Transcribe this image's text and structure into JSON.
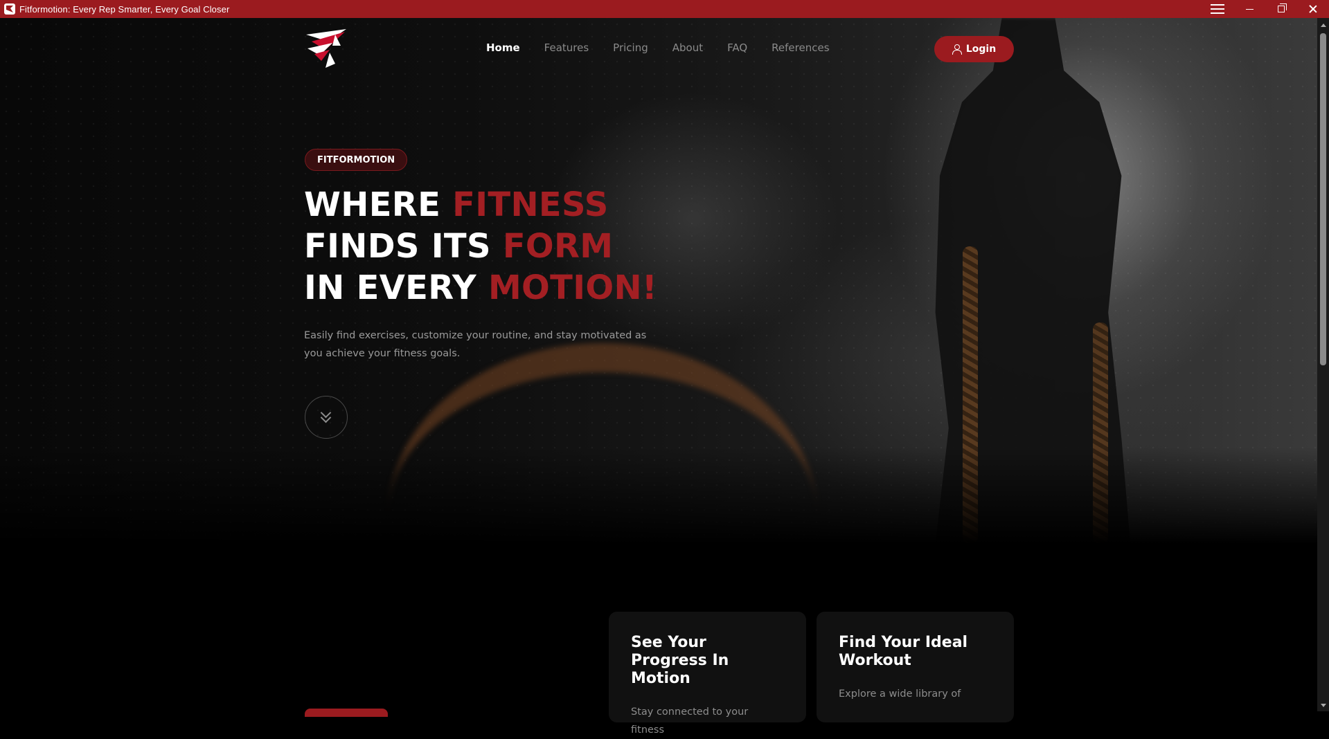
{
  "window": {
    "title": "Fitformotion: Every Rep Smarter, Every Goal Closer",
    "controls": [
      "menu-icon",
      "minimize-icon",
      "restore-icon",
      "close-icon"
    ]
  },
  "nav": {
    "logo_icon": "fitformotion-logo",
    "links": [
      {
        "label": "Home",
        "active": true
      },
      {
        "label": "Features",
        "active": false
      },
      {
        "label": "Pricing",
        "active": false
      },
      {
        "label": "About",
        "active": false
      },
      {
        "label": "FAQ",
        "active": false
      },
      {
        "label": "References",
        "active": false
      }
    ],
    "login_label": "Login",
    "login_icon": "user-icon"
  },
  "hero": {
    "badge": "FITFORMOTION",
    "headline": {
      "line1_white": "WHERE ",
      "line1_red": "FITNESS",
      "line2_white": "FINDS ITS ",
      "line2_red": "FORM",
      "line3_white": "IN EVERY ",
      "line3_red": "MOTION!"
    },
    "subtitle": "Easily find exercises, customize your routine, and stay motivated as you achieve your fitness goals.",
    "scroll_icon": "double-chevron-down-icon"
  },
  "features": {
    "cards": [
      {
        "title": "See Your Progress In Motion",
        "text": "Stay connected to your fitness"
      },
      {
        "title": "Find Your Ideal Workout",
        "text": "Explore a wide library of"
      }
    ]
  },
  "colors": {
    "accent": "#9b1b1f",
    "headline_red": "#a31f23",
    "background": "#000000",
    "card_bg": "#111111"
  }
}
